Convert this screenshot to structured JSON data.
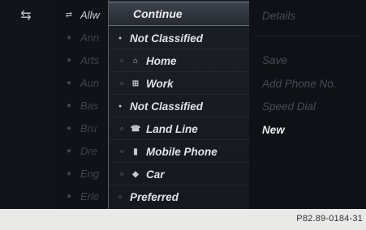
{
  "back_glyph": "⇆",
  "list": {
    "items": [
      {
        "label": "Allw",
        "icon": "⇄",
        "active": true
      },
      {
        "label": "Ann",
        "icon": "●",
        "active": false
      },
      {
        "label": "Arts",
        "icon": "●",
        "active": false
      },
      {
        "label": "Aun",
        "icon": "●",
        "active": false
      },
      {
        "label": "Bas",
        "icon": "●",
        "active": false
      },
      {
        "label": "Bru",
        "icon": "●",
        "active": false
      },
      {
        "label": "Dre",
        "icon": "●",
        "active": false
      },
      {
        "label": "Eng",
        "icon": "●",
        "active": false
      },
      {
        "label": "Erle",
        "icon": "●",
        "active": false
      }
    ]
  },
  "popup": {
    "header": "Continue",
    "rows": [
      {
        "label": "Not Classified",
        "mark": "●",
        "icon": "",
        "indent": false
      },
      {
        "label": "Home",
        "mark": "○",
        "icon": "⌂",
        "indent": true
      },
      {
        "label": "Work",
        "mark": "○",
        "icon": "⊞",
        "indent": true
      },
      {
        "label": "Not Classified",
        "mark": "●",
        "icon": "",
        "indent": false
      },
      {
        "label": "Land Line",
        "mark": "○",
        "icon": "☎",
        "indent": true
      },
      {
        "label": "Mobile Phone",
        "mark": "○",
        "icon": "▮",
        "indent": true
      },
      {
        "label": "Car",
        "mark": "○",
        "icon": "◆",
        "indent": true
      },
      {
        "label": "Preferred",
        "mark": "○",
        "icon": "",
        "indent": false
      }
    ]
  },
  "right": {
    "items": [
      {
        "label": "Details",
        "active": false
      },
      {
        "label": "Save",
        "active": false
      },
      {
        "label": "Add Phone No.",
        "active": false
      },
      {
        "label": "Speed Dial",
        "active": false
      },
      {
        "label": "New",
        "active": true
      }
    ]
  },
  "footer": {
    "code": "P82.89-0184-31"
  }
}
